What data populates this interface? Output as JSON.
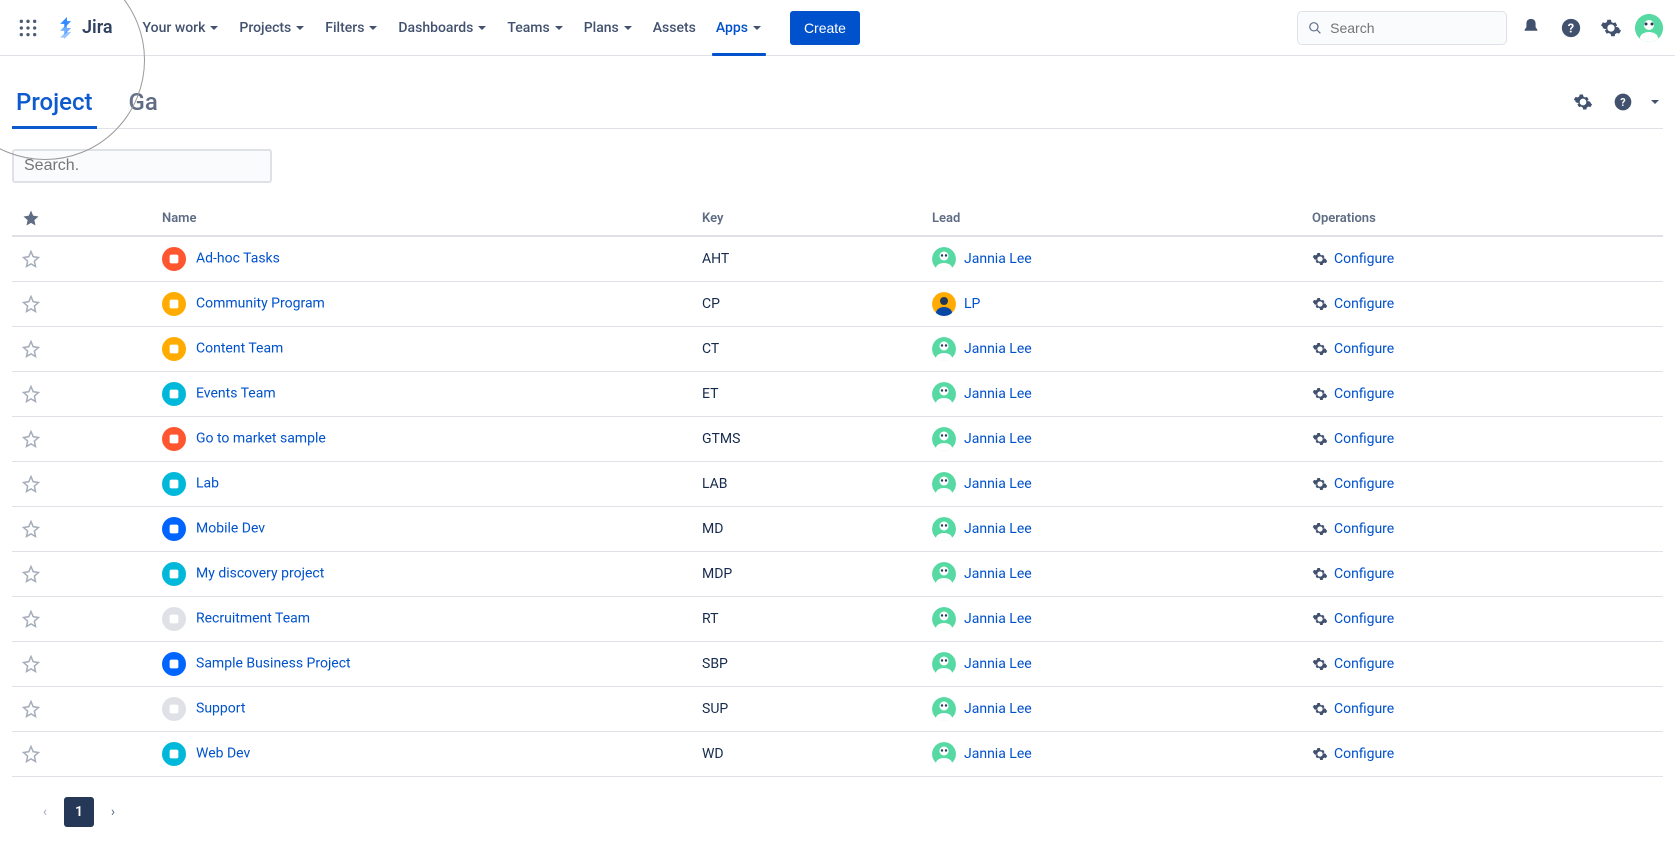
{
  "app": {
    "name": "Jira"
  },
  "nav": {
    "items": [
      {
        "label": "Your work",
        "dropdown": true
      },
      {
        "label": "Projects",
        "dropdown": true
      },
      {
        "label": "Filters",
        "dropdown": true
      },
      {
        "label": "Dashboards",
        "dropdown": true
      },
      {
        "label": "Teams",
        "dropdown": true
      },
      {
        "label": "Plans",
        "dropdown": true
      },
      {
        "label": "Assets",
        "dropdown": false
      },
      {
        "label": "Apps",
        "dropdown": true,
        "active": true
      }
    ],
    "create": "Create",
    "search_placeholder": "Search"
  },
  "tabs": [
    {
      "label": "Project",
      "active": true
    },
    {
      "label": "Ga"
    }
  ],
  "filter": {
    "placeholder": "Search."
  },
  "table": {
    "columns": {
      "star": "",
      "name": "Name",
      "key": "Key",
      "lead": "Lead",
      "operations": "Operations"
    },
    "configure_label": "Configure",
    "rows": [
      {
        "name": "Ad-hoc Tasks",
        "key": "AHT",
        "lead": "Jannia Lee",
        "icon_bg": "#FF5630",
        "lead_avatar": "green"
      },
      {
        "name": "Community Program",
        "key": "CP",
        "lead": "LP",
        "icon_bg": "#FFAB00",
        "lead_avatar": "person"
      },
      {
        "name": "Content Team",
        "key": "CT",
        "lead": "Jannia Lee",
        "icon_bg": "#FFAB00",
        "lead_avatar": "green"
      },
      {
        "name": "Events Team",
        "key": "ET",
        "lead": "Jannia Lee",
        "icon_bg": "#00B8D9",
        "lead_avatar": "green"
      },
      {
        "name": "Go to market sample",
        "key": "GTMS",
        "lead": "Jannia Lee",
        "icon_bg": "#FF5630",
        "lead_avatar": "green"
      },
      {
        "name": "Lab",
        "key": "LAB",
        "lead": "Jannia Lee",
        "icon_bg": "#00B8D9",
        "lead_avatar": "green"
      },
      {
        "name": "Mobile Dev",
        "key": "MD",
        "lead": "Jannia Lee",
        "icon_bg": "#0065FF",
        "lead_avatar": "green"
      },
      {
        "name": "My discovery project",
        "key": "MDP",
        "lead": "Jannia Lee",
        "icon_bg": "#00B8D9",
        "lead_avatar": "green"
      },
      {
        "name": "Recruitment Team",
        "key": "RT",
        "lead": "Jannia Lee",
        "icon_bg": "#DFE1E6",
        "lead_avatar": "green"
      },
      {
        "name": "Sample Business Project",
        "key": "SBP",
        "lead": "Jannia Lee",
        "icon_bg": "#0065FF",
        "lead_avatar": "green"
      },
      {
        "name": "Support",
        "key": "SUP",
        "lead": "Jannia Lee",
        "icon_bg": "#DFE1E6",
        "lead_avatar": "green"
      },
      {
        "name": "Web Dev",
        "key": "WD",
        "lead": "Jannia Lee",
        "icon_bg": "#00B8D9",
        "lead_avatar": "green"
      }
    ]
  },
  "pagination": {
    "current": "1"
  }
}
